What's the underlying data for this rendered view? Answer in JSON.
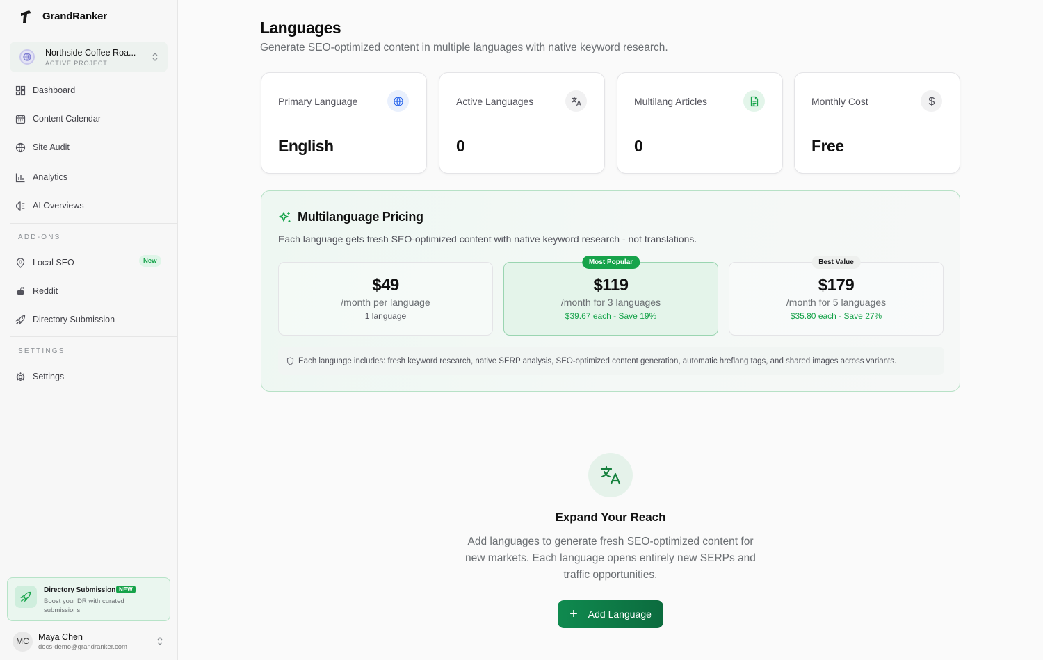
{
  "brand": {
    "name": "GrandRanker"
  },
  "project": {
    "name": "Northside Coffee Roa...",
    "subtitle": "ACTIVE PROJECT"
  },
  "nav": {
    "items": [
      {
        "label": "Dashboard",
        "icon": "dashboard-icon"
      },
      {
        "label": "Content Calendar",
        "icon": "calendar-icon"
      },
      {
        "label": "Site Audit",
        "icon": "globe-icon"
      },
      {
        "label": "Analytics",
        "icon": "bar-chart-icon"
      },
      {
        "label": "AI Overviews",
        "icon": "brain-icon"
      }
    ],
    "addons_heading": "ADD-ONS",
    "addons": [
      {
        "label": "Local SEO",
        "badge": "New",
        "icon": "map-pin-icon"
      },
      {
        "label": "Reddit",
        "icon": "reddit-icon"
      },
      {
        "label": "Directory Submission",
        "icon": "rocket-icon"
      }
    ],
    "settings_heading": "SETTINGS",
    "settings": [
      {
        "label": "Settings",
        "icon": "gear-icon"
      }
    ]
  },
  "promo": {
    "title": "Directory Submission",
    "badge": "NEW",
    "description": "Boost your DR with curated submissions"
  },
  "user": {
    "initials": "MC",
    "name": "Maya Chen",
    "email": "docs-demo@grandranker.com"
  },
  "header": {
    "title": "Languages",
    "subtitle": "Generate SEO-optimized content in multiple languages with native keyword research."
  },
  "stats": [
    {
      "label": "Primary Language",
      "value": "English",
      "icon": "globe-icon",
      "icon_color": "#2563eb"
    },
    {
      "label": "Active Languages",
      "value": "0",
      "icon": "translate-icon",
      "icon_color": "#52525b"
    },
    {
      "label": "Multilang Articles",
      "value": "0",
      "icon": "document-icon",
      "icon_color": "#16a34a"
    },
    {
      "label": "Monthly Cost",
      "value": "Free",
      "icon": "dollar-icon",
      "icon_color": "#52525b"
    }
  ],
  "pricing": {
    "title": "Multilanguage Pricing",
    "subtitle": "Each language gets fresh SEO-optimized content with native keyword research - not translations.",
    "plans": [
      {
        "price": "$49",
        "period": "/month per language",
        "note": "1 language",
        "tag": ""
      },
      {
        "price": "$119",
        "period": "/month for 3 languages",
        "note": "$39.67 each - Save 19%",
        "tag": "Most Popular"
      },
      {
        "price": "$179",
        "period": "/month for 5 languages",
        "note": "$35.80 each - Save 27%",
        "tag": "Best Value"
      }
    ],
    "includes": "Each language includes: fresh keyword research, native SERP analysis, SEO-optimized content generation, automatic hreflang tags, and shared images across variants."
  },
  "empty_state": {
    "title": "Expand Your Reach",
    "description": "Add languages to generate fresh SEO-optimized content for new markets. Each language opens entirely new SERPs and traffic opportunities.",
    "button_label": "Add Language"
  },
  "colors": {
    "accent": "#16a34a",
    "button": "#0f8a4f",
    "pricing_border": "#b7e1c6"
  }
}
